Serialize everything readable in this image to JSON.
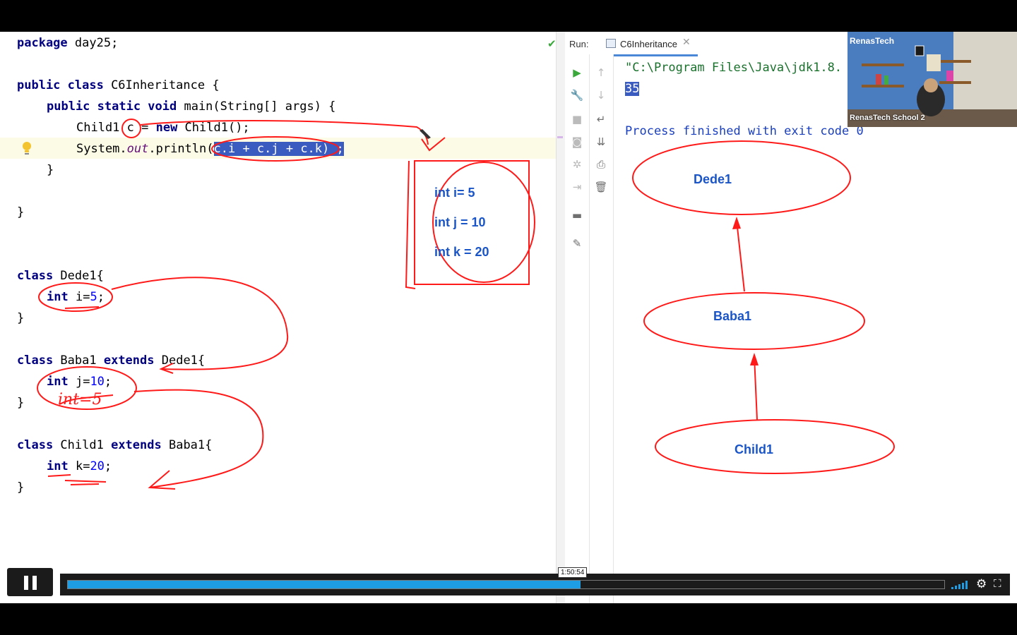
{
  "editor": {
    "lines": {
      "l1_kw": "package",
      "l1_rest": " day25;",
      "l3_kw": "public class",
      "l3_rest": " C6Inheritance {",
      "l4_kw": "public static void",
      "l4_rest": " main(String[] args) {",
      "l5_a": "Child1 c = ",
      "l5_kw": "new",
      "l5_b": " Child1();",
      "l6_a": "System.",
      "l6_ital": "out",
      "l6_b": ".println(",
      "l6_sel": "c.i + c.j + c.k) ;",
      "l7": "}",
      "l9": "}",
      "l12_kw": "class",
      "l12_rest": " Dede1{",
      "l13_kw": "int",
      "l13_a": " i=",
      "l13_num": "5",
      "l13_b": ";",
      "l14": "}",
      "l16_kw": "class",
      "l16_a": " Baba1 ",
      "l16_kw2": "extends",
      "l16_b": " Dede1{",
      "l17_kw": "int",
      "l17_a": " j=",
      "l17_num": "10",
      "l17_b": ";",
      "l18": "}",
      "l20_kw": "class",
      "l20_a": " Child1 ",
      "l20_kw2": "extends",
      "l20_b": " Baba1{",
      "l21_kw": "int",
      "l21_a": " k=",
      "l21_num": "20",
      "l21_b": ";",
      "l22": "}"
    }
  },
  "run_panel": {
    "label": "Run:",
    "tab": "C6Inheritance",
    "console": {
      "command": "\"C:\\Program Files\\Java\\jdk1.8.",
      "output": "35",
      "finished": "Process finished with exit code 0"
    }
  },
  "annotations": {
    "box_lines": [
      "int i= 5",
      "int j = 10",
      "int k = 20"
    ],
    "handwritten_note": "int=5",
    "diagram_nodes": [
      "Dede1",
      "Baba1",
      "Child1"
    ]
  },
  "webcam": {
    "logo": "RenasTech",
    "label": "RenasTech School 2"
  },
  "video": {
    "time_tooltip": "1:50:54",
    "progress_fraction": 0.585
  },
  "colors": {
    "keyword": "#000080",
    "number": "#0000ff",
    "selection": "#3a5bbf",
    "annotation": "#ff0000",
    "diagram_text": "#1a55c8",
    "progress": "#1e9ce4"
  }
}
